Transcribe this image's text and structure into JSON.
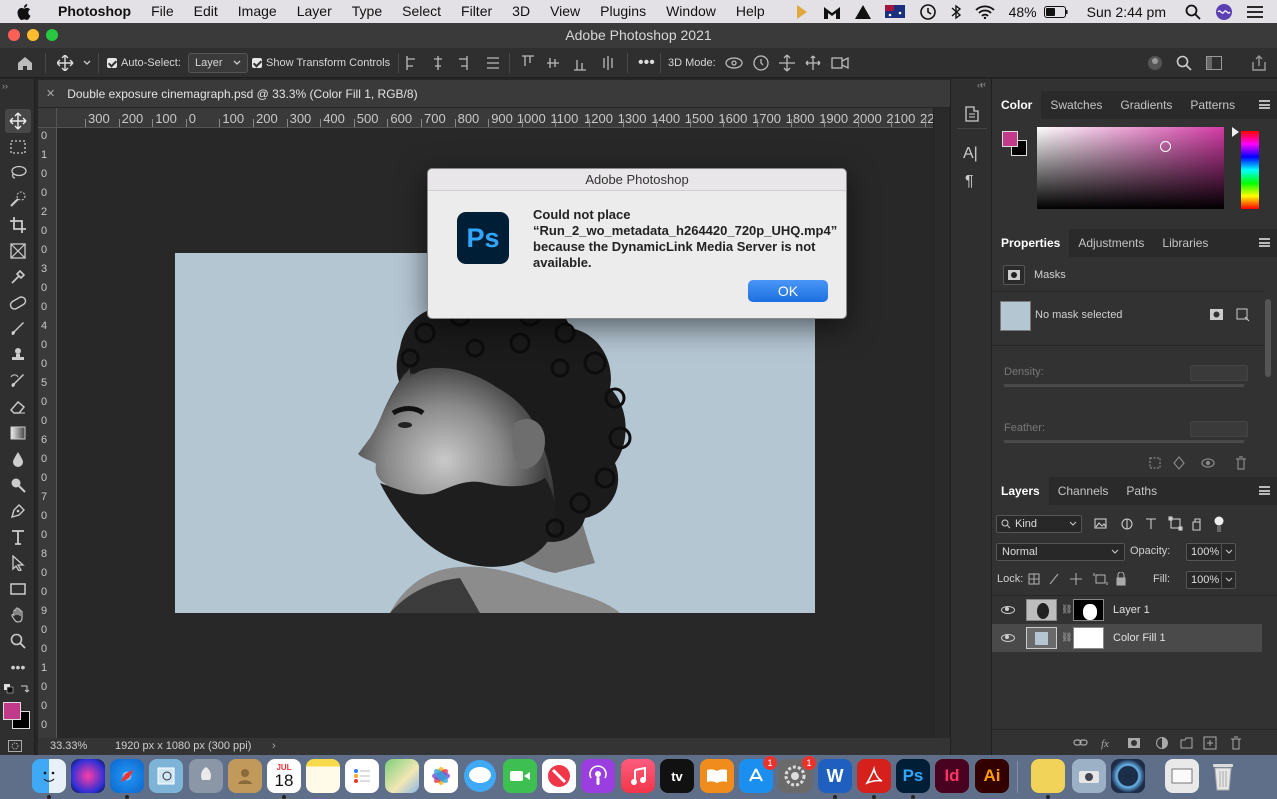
{
  "menubar": {
    "app": "Photoshop",
    "items": [
      "File",
      "Edit",
      "Image",
      "Layer",
      "Type",
      "Select",
      "Filter",
      "3D",
      "View",
      "Plugins",
      "Window",
      "Help"
    ],
    "battery": "48%",
    "clock": "Sun 2:44 pm"
  },
  "window": {
    "title": "Adobe Photoshop 2021"
  },
  "options": {
    "auto_select_label": "Auto-Select:",
    "auto_select_value": "Layer",
    "transform_label": "Show Transform Controls",
    "mode_3d_label": "3D Mode:"
  },
  "document": {
    "tab_title": "Double exposure cinemagraph.psd @ 33.3% (Color Fill 1, RGB/8)",
    "zoom": "33.33%",
    "dimensions": "1920 px x 1080 px (300 ppi)"
  },
  "ruler_top": [
    "300",
    "200",
    "100",
    "0",
    "100",
    "200",
    "300",
    "400",
    "500",
    "600",
    "700",
    "800",
    "900",
    "1000",
    "1100",
    "1200",
    "1300",
    "1400",
    "1500",
    "1600",
    "1700",
    "1800",
    "1900",
    "2000",
    "2100",
    "2200"
  ],
  "ruler_left": [
    "0",
    "1",
    "0",
    "0",
    "2",
    "0",
    "0",
    "3",
    "0",
    "0",
    "4",
    "0",
    "0",
    "5",
    "0",
    "0",
    "6",
    "0",
    "0",
    "7",
    "0",
    "0",
    "8",
    "0",
    "0",
    "9",
    "0",
    "0",
    "1",
    "0",
    "0",
    "0"
  ],
  "dialog": {
    "title": "Adobe Photoshop",
    "icon_text": "Ps",
    "message": "Could not place “Run_2_wo_metadata_h264420_720p_UHQ.mp4” because the DynamicLink Media Server is not available.",
    "ok_label": "OK"
  },
  "color_panel": {
    "tabs": [
      "Color",
      "Swatches",
      "Gradients",
      "Patterns"
    ],
    "foreground": "#c23a8a",
    "hue_color": "#d43ba6"
  },
  "properties_panel": {
    "tabs": [
      "Properties",
      "Adjustments",
      "Libraries"
    ],
    "section": "Masks",
    "mask_status": "No mask selected",
    "density_label": "Density:",
    "feather_label": "Feather:"
  },
  "layers_panel": {
    "tabs": [
      "Layers",
      "Channels",
      "Paths"
    ],
    "filter_kind": "Kind",
    "blend_mode": "Normal",
    "opacity_label": "Opacity:",
    "opacity_value": "100%",
    "lock_label": "Lock:",
    "fill_label": "Fill:",
    "fill_value": "100%",
    "layers": [
      {
        "name": "Layer 1"
      },
      {
        "name": "Color Fill 1"
      }
    ]
  },
  "dock": {
    "calendar_month": "JUL",
    "calendar_day": "18",
    "appstore_badge": "1",
    "settings_badge": "1",
    "apps": [
      "Finder",
      "Siri",
      "Safari",
      "Preview",
      "Launchpad",
      "Contacts",
      "Calendar",
      "Notes",
      "Reminders",
      "Maps",
      "Photos",
      "Messages",
      "FaceTime",
      "News",
      "Podcasts",
      "Music",
      "TV",
      "Books",
      "App Store",
      "System Preferences",
      "Word",
      "Acrobat",
      "Photoshop",
      "InDesign",
      "Illustrator",
      "Stickies",
      "Image Capture",
      "QuickTime",
      "Screenshot",
      "Trash"
    ],
    "word_label": "W",
    "ps_label": "Ps",
    "id_label": "Id",
    "ai_label": "Ai",
    "tv_label": "tv"
  }
}
